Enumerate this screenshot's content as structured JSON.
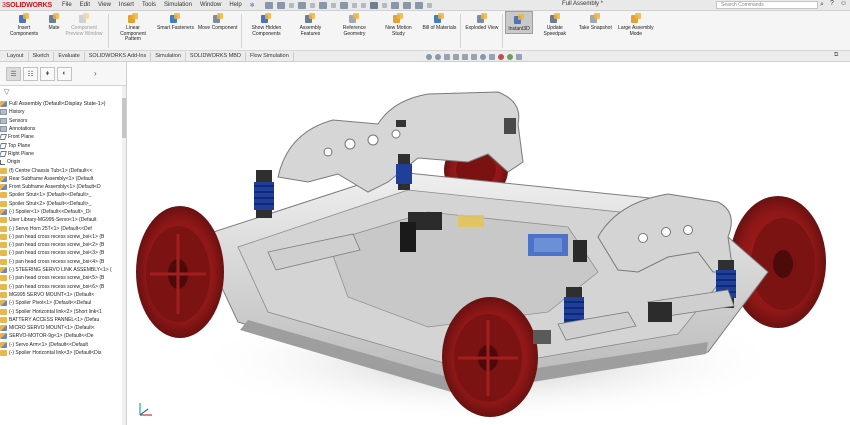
{
  "app": {
    "brand": "SOLIDWORKS",
    "document_title": "Full Assembly *"
  },
  "menu": [
    "File",
    "Edit",
    "View",
    "Insert",
    "Tools",
    "Simulation",
    "Window",
    "Help"
  ],
  "search": {
    "placeholder": "Search Commands"
  },
  "ribbon": {
    "buttons": [
      {
        "name": "insert-components-button",
        "label": "Insert Components",
        "icon": "insert-component-icon",
        "state": "normal"
      },
      {
        "name": "mate-button",
        "label": "Mate",
        "icon": "paperclip-icon",
        "state": "normal"
      },
      {
        "name": "component-preview-window-button",
        "label": "Component Preview Window",
        "icon": "preview-window-icon",
        "state": "disabled"
      },
      {
        "name": "linear-component-pattern-button",
        "label": "Linear Component Pattern",
        "icon": "pattern-icon",
        "state": "normal"
      },
      {
        "name": "smart-fasteners-button",
        "label": "Smart Fasteners",
        "icon": "fastener-icon",
        "state": "normal"
      },
      {
        "name": "move-component-button",
        "label": "Move Component",
        "icon": "move-icon",
        "state": "normal"
      },
      {
        "name": "show-hidden-components-button",
        "label": "Show Hidden Components",
        "icon": "show-hidden-icon",
        "state": "normal"
      },
      {
        "name": "assembly-features-button",
        "label": "Assembly Features",
        "icon": "assembly-feature-icon",
        "state": "normal"
      },
      {
        "name": "reference-geometry-button",
        "label": "Reference Geometry",
        "icon": "reference-geometry-icon",
        "state": "normal"
      },
      {
        "name": "new-motion-study-button",
        "label": "New Motion Study",
        "icon": "motion-study-icon",
        "state": "normal"
      },
      {
        "name": "bill-of-materials-button",
        "label": "Bill of Materials",
        "icon": "bom-icon",
        "state": "normal"
      },
      {
        "name": "exploded-view-button",
        "label": "Exploded View",
        "icon": "exploded-view-icon",
        "state": "normal"
      },
      {
        "name": "instant3d-button",
        "label": "Instant3D",
        "icon": "instant3d-icon",
        "state": "active"
      },
      {
        "name": "update-speedpak-button",
        "label": "Update Speedpak",
        "icon": "speedpak-icon",
        "state": "normal"
      },
      {
        "name": "take-snapshot-button",
        "label": "Take Snapshot",
        "icon": "camera-icon",
        "state": "normal"
      },
      {
        "name": "large-assembly-mode-button",
        "label": "Large Assembly Mode",
        "icon": "large-assembly-icon",
        "state": "normal"
      }
    ]
  },
  "tabs": [
    "Layout",
    "Sketch",
    "Evaluate",
    "SOLIDWORKS Add-Ins",
    "Simulation",
    "SOLIDWORKS MBD",
    "Flow Simulation"
  ],
  "active_tab": "Assembly",
  "feature_tree": {
    "root": "Full Assembly  (Default<Display State-1>)",
    "items": [
      {
        "label": "History",
        "icon": "folder-icon"
      },
      {
        "label": "Sensors",
        "icon": "sensor-icon"
      },
      {
        "label": "Annotations",
        "icon": "annotation-icon"
      },
      {
        "label": "Front Plane",
        "icon": "plane-icon"
      },
      {
        "label": "Top Plane",
        "icon": "plane-icon"
      },
      {
        "label": "Right Plane",
        "icon": "plane-icon"
      },
      {
        "label": "Origin",
        "icon": "origin-icon"
      },
      {
        "label": "(f) Centre Chassis Tub<1> (Default<<",
        "icon": "part-icon"
      },
      {
        "label": "Rear Subframe Assembly<1> (Default",
        "icon": "assembly-icon"
      },
      {
        "label": "Front Subframe Assembly<1> (Default<D",
        "icon": "assembly-icon"
      },
      {
        "label": "Spoiler Strut<1> (Default<<Default>_",
        "icon": "part-icon"
      },
      {
        "label": "Spoiler Strut<2> (Default<<Default>_",
        "icon": "part-icon"
      },
      {
        "label": "(-) Spoiler<1> (Default<<Default>_Di",
        "icon": "assembly-icon"
      },
      {
        "label": "User Library-MG995-Servo<1> (Default",
        "icon": "part-icon"
      },
      {
        "label": "(-) Servo Horn 25T<1> (Default<<Def",
        "icon": "part-icon"
      },
      {
        "label": "(-) pan head cross recess screw_bsi<1> (B",
        "icon": "part-icon"
      },
      {
        "label": "(-) pan head cross recess screw_bsi<2> (B",
        "icon": "part-icon"
      },
      {
        "label": "(-) pan head cross recess screw_bsi<3> (B",
        "icon": "part-icon"
      },
      {
        "label": "(-) pan head cross recess screw_bsi<4> (B",
        "icon": "part-icon"
      },
      {
        "label": "(-) STEERING SERVO LINK ASSEMBLY<1> (",
        "icon": "assembly-icon"
      },
      {
        "label": "(-) pan head cross recess screw_bsi<5> (B",
        "icon": "part-icon"
      },
      {
        "label": "(-) pan head cross recess screw_bsi<6> (B",
        "icon": "part-icon"
      },
      {
        "label": "MG995 SERVO MOUNT<1> (Default<",
        "icon": "part-icon"
      },
      {
        "label": "(-) Spoiler Pivot<1> (Default<<Defaul",
        "icon": "assembly-icon"
      },
      {
        "label": "(-) Spoiler Horizontal link<2> (Short link<1",
        "icon": "part-icon"
      },
      {
        "label": "BATTERY ACCESS PANNEL<1> (Defau",
        "icon": "part-icon"
      },
      {
        "label": "MICRO SERVO MOUNT<1> (Default<",
        "icon": "assembly-icon"
      },
      {
        "label": "SERVO-MOTOR-9g<1> (Default<<De",
        "icon": "assembly-icon"
      },
      {
        "label": "(-) Servo Arm<1> (Default<<Default",
        "icon": "assembly-icon"
      },
      {
        "label": "(-) Spoiler Horizontal link<3> (Default<Dis",
        "icon": "part-icon"
      }
    ]
  },
  "colors": {
    "brand": "#d1111b",
    "wheel": "#8e1717",
    "chassis": "#d9d9d9",
    "spring": "#1f3f9a"
  }
}
